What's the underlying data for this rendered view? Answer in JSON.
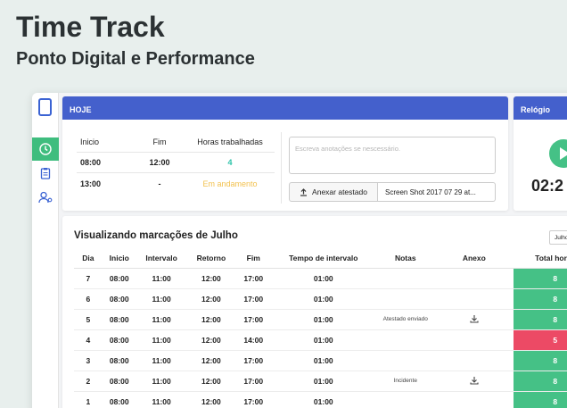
{
  "hero": {
    "title": "Time Track",
    "subtitle": "Ponto Digital e Performance"
  },
  "sidebar": {
    "items": [
      {
        "icon": "clock-icon",
        "active": true
      },
      {
        "icon": "clipboard-icon",
        "active": false
      },
      {
        "icon": "user-settings-icon",
        "active": false
      }
    ]
  },
  "today": {
    "header": "HOJE",
    "columns": [
      "Inicio",
      "Fim",
      "Horas trabalhadas"
    ],
    "rows": [
      {
        "start": "08:00",
        "end": "12:00",
        "hours": "4"
      },
      {
        "start": "13:00",
        "end": "-",
        "hours": "Em andamento"
      }
    ],
    "notes_placeholder": "Escreva anotações se nescessário.",
    "attach_label": "Anexar atestado",
    "attached_file": "Screen Shot 2017 07 29 at..."
  },
  "clock": {
    "header": "Relógio",
    "time": "02:2"
  },
  "marks": {
    "title": "Visualizando marcações de Julho",
    "month_select": "Julho",
    "columns": [
      "Dia",
      "Inicio",
      "Intervalo",
      "Retorno",
      "Fim",
      "Tempo de intervalo",
      "Notas",
      "Anexo",
      "Total horas"
    ],
    "rows": [
      {
        "day": "7",
        "start": "08:00",
        "break": "11:00",
        "return": "12:00",
        "end": "17:00",
        "interval": "01:00",
        "note": "",
        "attach": false,
        "total": "8"
      },
      {
        "day": "6",
        "start": "08:00",
        "break": "11:00",
        "return": "12:00",
        "end": "17:00",
        "interval": "01:00",
        "note": "",
        "attach": false,
        "total": "8"
      },
      {
        "day": "5",
        "start": "08:00",
        "break": "11:00",
        "return": "12:00",
        "end": "17:00",
        "interval": "01:00",
        "note": "Atestado enviado",
        "attach": true,
        "total": "8"
      },
      {
        "day": "4",
        "start": "08:00",
        "break": "11:00",
        "return": "12:00",
        "end": "14:00",
        "interval": "01:00",
        "note": "",
        "attach": false,
        "total": "5"
      },
      {
        "day": "3",
        "start": "08:00",
        "break": "11:00",
        "return": "12:00",
        "end": "17:00",
        "interval": "01:00",
        "note": "",
        "attach": false,
        "total": "8"
      },
      {
        "day": "2",
        "start": "08:00",
        "break": "11:00",
        "return": "12:00",
        "end": "17:00",
        "interval": "01:00",
        "note": "Incidente",
        "attach": true,
        "total": "8"
      },
      {
        "day": "1",
        "start": "08:00",
        "break": "11:00",
        "return": "12:00",
        "end": "17:00",
        "interval": "01:00",
        "note": "",
        "attach": false,
        "total": "8"
      }
    ]
  },
  "colors": {
    "accent": "#4460cc",
    "green": "#45c186",
    "red": "#ec4a65",
    "in_progress": "#f2c14e",
    "hours_done": "#2bc2a8"
  }
}
